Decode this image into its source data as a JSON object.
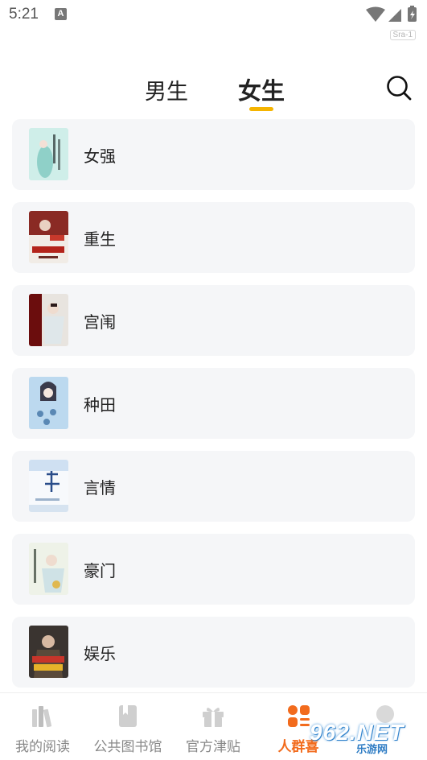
{
  "status": {
    "time": "5:21",
    "notification_letter": "A",
    "carrier": "Sra-1"
  },
  "tabs": {
    "male": "男生",
    "female": "女生",
    "active": "female"
  },
  "colors": {
    "accent": "#f5b400",
    "active_nav": "#f26b1d",
    "card_bg": "#f5f6f8"
  },
  "categories": [
    {
      "label": "女强",
      "cover_icon": "book-cover-icon"
    },
    {
      "label": "重生",
      "cover_icon": "book-cover-icon"
    },
    {
      "label": "宫闱",
      "cover_icon": "book-cover-icon"
    },
    {
      "label": "种田",
      "cover_icon": "book-cover-icon"
    },
    {
      "label": "言情",
      "cover_icon": "book-cover-icon"
    },
    {
      "label": "豪门",
      "cover_icon": "book-cover-icon"
    },
    {
      "label": "娱乐",
      "cover_icon": "book-cover-icon"
    }
  ],
  "bottom_nav": [
    {
      "label": "我的阅读",
      "icon": "bookshelf-icon",
      "active": false
    },
    {
      "label": "公共图书馆",
      "icon": "book-icon",
      "active": false
    },
    {
      "label": "官方津贴",
      "icon": "gift-icon",
      "active": false
    },
    {
      "label": "人群喜",
      "icon": "grid-icon",
      "active": true
    }
  ],
  "watermark": {
    "brand": "962.NET",
    "sub": "乐游网"
  }
}
